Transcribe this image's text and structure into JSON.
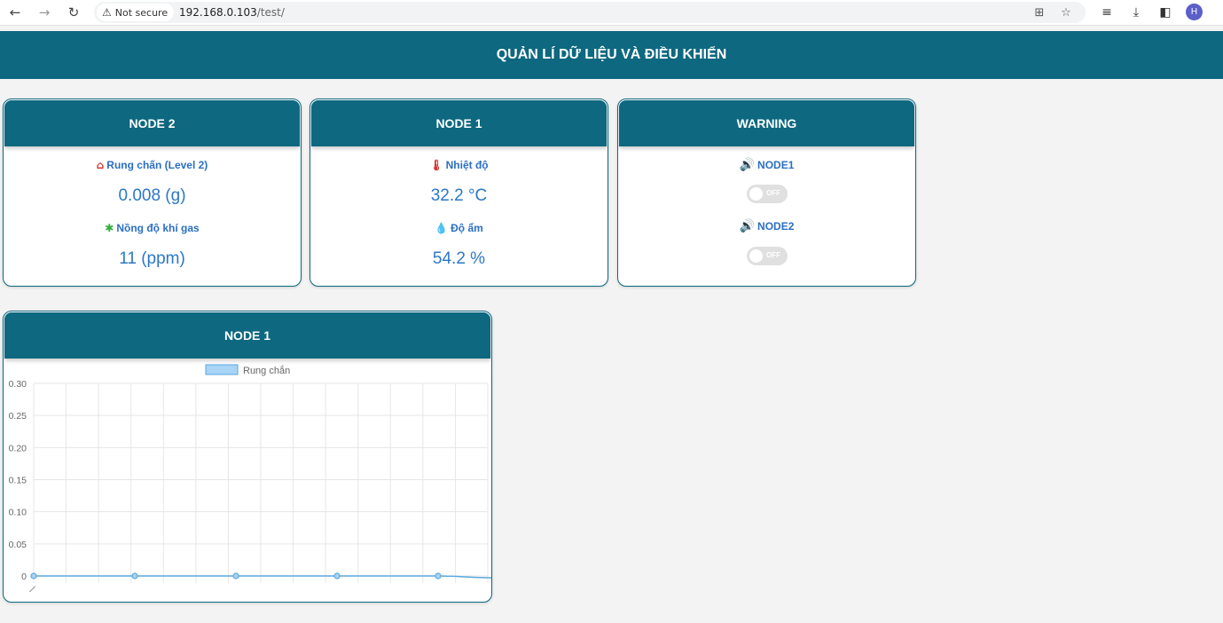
{
  "browser": {
    "security_label": "Not secure",
    "url_host": "192.168.0.103",
    "url_path": "/test/",
    "avatar_letter": "H"
  },
  "page": {
    "title": "QUẢN LÍ DỮ LIỆU VÀ ĐIỀU KHIỂN"
  },
  "node2_card": {
    "title": "NODE 2",
    "vibration_label": "Rung chấn (Level 2)",
    "vibration_value": "0.008 (g)",
    "gas_label": "Nồng độ khí gas",
    "gas_value": "11 (ppm)"
  },
  "node1_card": {
    "title": "NODE 1",
    "temp_label": "Nhiệt độ",
    "temp_value": "32.2 °C",
    "humidity_label": "Độ ẩm",
    "humidity_value": "54.2 %"
  },
  "warning_card": {
    "title": "WARNING",
    "node1_label": "NODE1",
    "node1_state": "OFF",
    "node2_label": "NODE2",
    "node2_state": "OFF"
  },
  "chart_card": {
    "title": "NODE 1"
  },
  "colors": {
    "primary": "#0d6880",
    "value_blue": "#2b77c9",
    "warning_red": "#d0342c",
    "series": "#5aa9df"
  },
  "chart_data": {
    "type": "line",
    "legend": [
      "Rung chắn"
    ],
    "series": [
      {
        "name": "Rung chắn",
        "values": [
          0,
          0,
          0,
          0,
          0
        ]
      }
    ],
    "yticks": [
      "0.30",
      "0.25",
      "0.20",
      "0.15",
      "0.10",
      "0.05",
      "0"
    ],
    "ylim": [
      0,
      0.3
    ],
    "grid": true
  }
}
